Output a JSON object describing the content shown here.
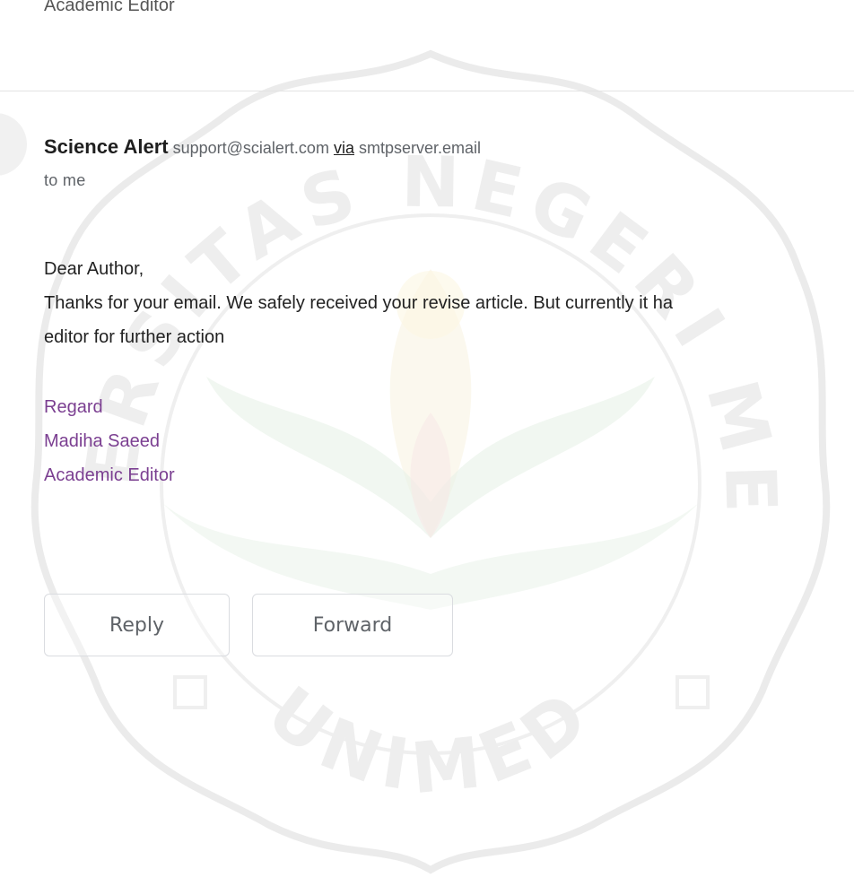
{
  "previous_message": {
    "signature_title": "Academic Editor"
  },
  "message": {
    "sender_name": "Science Alert",
    "sender_email": "support@scialert.com",
    "via_label": "via",
    "via_host": "smtpserver.email",
    "recipient_line": "to me",
    "greeting": "Dear Author,",
    "body_line_1": "Thanks for your email. We safely received your revise article. But currently it ha",
    "body_line_2": "editor for further action",
    "signature": {
      "closing": "Regard",
      "name": "Madiha Saeed",
      "title": "Academic Editor"
    }
  },
  "actions": {
    "reply_label": "Reply",
    "forward_label": "Forward"
  },
  "watermark": {
    "top_text": "UNIVERSITAS NEGERI MEDAN",
    "bottom_text": "UNIMED"
  },
  "colors": {
    "signature_text": "#7b3f91",
    "meta_text": "#5f6368",
    "button_border": "#dadce0"
  }
}
